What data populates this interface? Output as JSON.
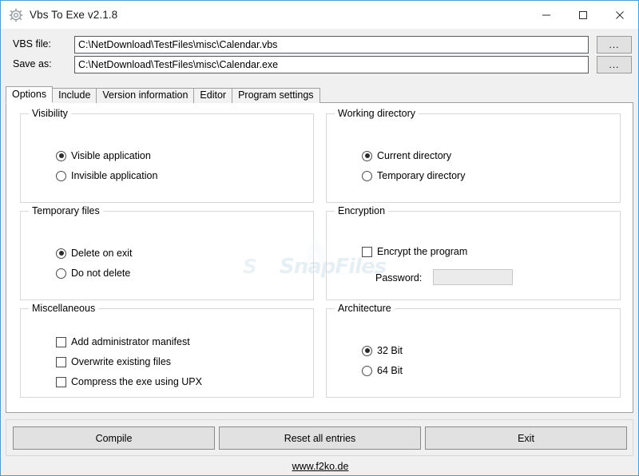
{
  "window": {
    "title": "Vbs To Exe v2.1.8",
    "icon": "gear-icon",
    "minimize_label": "─",
    "maximize_label": "□",
    "close_label": "✕",
    "border_color": "#4b9cd3"
  },
  "files": {
    "vbs_label": "VBS file:",
    "vbs_value": "C:\\NetDownload\\TestFiles\\misc\\Calendar.vbs",
    "vbs_placeholder": "",
    "save_label": "Save as:",
    "save_value": "C:\\NetDownload\\TestFiles\\misc\\Calendar.exe",
    "save_placeholder": "",
    "browse_label": "..."
  },
  "tabs": [
    {
      "label": "Options",
      "active": true
    },
    {
      "label": "Include",
      "active": false
    },
    {
      "label": "Version information",
      "active": false
    },
    {
      "label": "Editor",
      "active": false
    },
    {
      "label": "Program settings",
      "active": false
    }
  ],
  "groups": {
    "visibility": {
      "title": "Visibility",
      "options": [
        {
          "label": "Visible application",
          "selected": true
        },
        {
          "label": "Invisible application",
          "selected": false
        }
      ]
    },
    "working_directory": {
      "title": "Working directory",
      "options": [
        {
          "label": "Current directory",
          "selected": true
        },
        {
          "label": "Temporary directory",
          "selected": false
        }
      ]
    },
    "temporary_files": {
      "title": "Temporary files",
      "options": [
        {
          "label": "Delete on exit",
          "selected": true
        },
        {
          "label": "Do not delete",
          "selected": false
        }
      ]
    },
    "encryption": {
      "title": "Encryption",
      "checkbox_label": "Encrypt the program",
      "checkbox_checked": false,
      "password_label": "Password:",
      "password_value": "",
      "password_placeholder": "",
      "password_disabled": true
    },
    "miscellaneous": {
      "title": "Miscellaneous",
      "options": [
        {
          "label": "Add administrator manifest",
          "checked": false
        },
        {
          "label": "Overwrite existing files",
          "checked": false
        },
        {
          "label": "Compress the exe using UPX",
          "checked": false
        }
      ]
    },
    "architecture": {
      "title": "Architecture",
      "options": [
        {
          "label": "32 Bit",
          "selected": true
        },
        {
          "label": "64 Bit",
          "selected": false
        }
      ]
    }
  },
  "actions": {
    "compile": "Compile",
    "reset": "Reset all entries",
    "exit": "Exit"
  },
  "footer": {
    "link": "www.f2ko.de"
  },
  "watermark": {
    "text": "SnapFiles",
    "badge": "S",
    "color": "#cfe0ea"
  }
}
